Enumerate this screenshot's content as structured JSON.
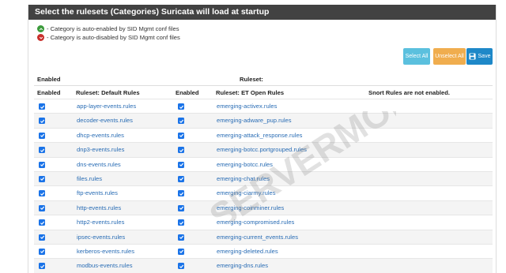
{
  "panel": {
    "title": "Select the rulesets (Categories) Suricata will load at startup"
  },
  "legend": {
    "enabled": "- Category is auto-enabled by SID Mgmt conf files",
    "disabled": "- Category is auto-disabled by SID Mgmt conf files"
  },
  "buttons": {
    "select_all": "Select All",
    "unselect_all": "Unselect All",
    "save": "Save"
  },
  "groups": {
    "enabled": "Enabled",
    "ruleset": "Ruleset:"
  },
  "columns": {
    "enabled1": "Enabled",
    "default_rules": "Ruleset: Default Rules",
    "enabled2": "Enabled",
    "et_open_rules": "Ruleset: ET Open Rules",
    "snort": "Snort Rules are not enabled."
  },
  "rows": [
    {
      "default": "app-layer-events.rules",
      "et": "emerging-activex.rules"
    },
    {
      "default": "decoder-events.rules",
      "et": "emerging-adware_pup.rules"
    },
    {
      "default": "dhcp-events.rules",
      "et": "emerging-attack_response.rules"
    },
    {
      "default": "dnp3-events.rules",
      "et": "emerging-botcc.portgrouped.rules"
    },
    {
      "default": "dns-events.rules",
      "et": "emerging-botcc.rules"
    },
    {
      "default": "files.rules",
      "et": "emerging-chat.rules"
    },
    {
      "default": "ftp-events.rules",
      "et": "emerging-ciarmy.rules"
    },
    {
      "default": "http-events.rules",
      "et": "emerging-coinminer.rules"
    },
    {
      "default": "http2-events.rules",
      "et": "emerging-compromised.rules"
    },
    {
      "default": "ipsec-events.rules",
      "et": "emerging-current_events.rules"
    },
    {
      "default": "kerberos-events.rules",
      "et": "emerging-deleted.rules"
    },
    {
      "default": "modbus-events.rules",
      "et": "emerging-dns.rules"
    }
  ],
  "watermark": {
    "brand": "SERVERMON"
  }
}
